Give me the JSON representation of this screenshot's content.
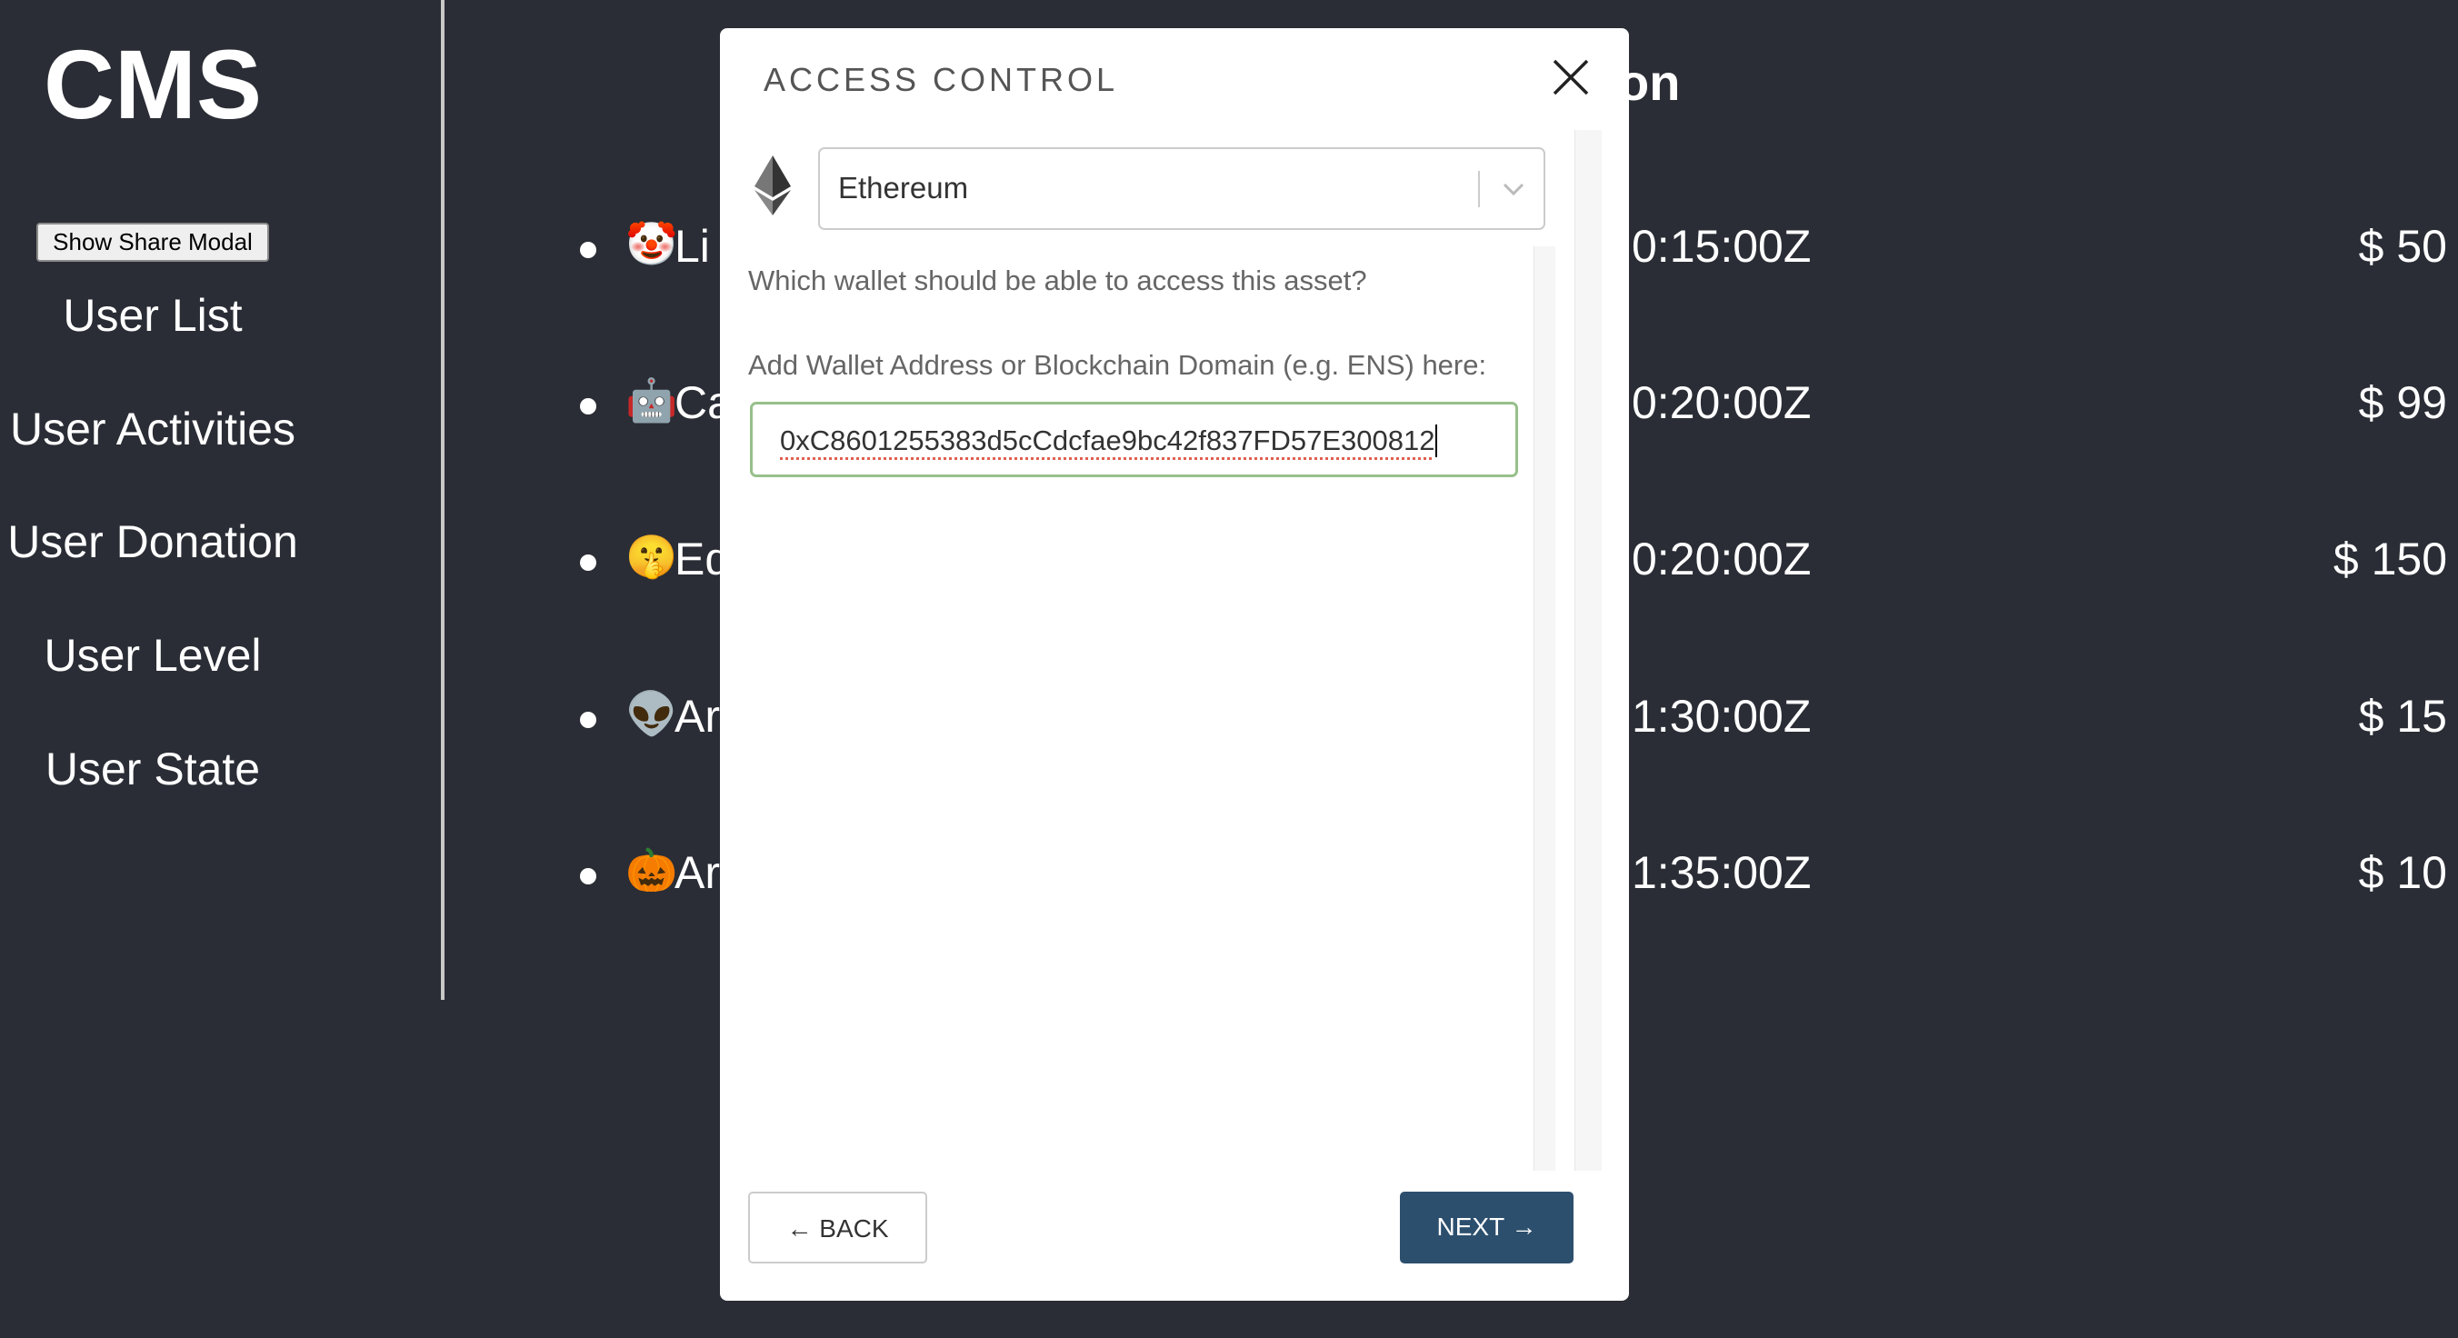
{
  "sidebar": {
    "title": "CMS",
    "share_button": "Show Share Modal",
    "items": [
      "User List",
      "User Activities",
      "User Donation",
      "User Level",
      "User State"
    ]
  },
  "main": {
    "title_visible": "on",
    "rows": [
      {
        "emoji": "🤡",
        "name": "Li",
        "time": "0:15:00Z",
        "amount": "$ 50"
      },
      {
        "emoji": "🤖",
        "name": "Ca",
        "time": "0:20:00Z",
        "amount": "$ 99"
      },
      {
        "emoji": "🤫",
        "name": "Ed",
        "time": "0:20:00Z",
        "amount": "$ 150"
      },
      {
        "emoji": "👽",
        "name": "Ar",
        "time": "1:30:00Z",
        "amount": "$ 15"
      },
      {
        "emoji": "🎃",
        "name": "Ar",
        "time": "1:35:00Z",
        "amount": "$ 10"
      }
    ]
  },
  "modal": {
    "title": "ACCESS CONTROL",
    "chain_icon": "ethereum-icon",
    "chain": "Ethereum",
    "question": "Which wallet should be able to access this asset?",
    "address_label": "Add Wallet Address or Blockchain Domain (e.g. ENS) here:",
    "address_value": "0xC8601255383d5cCdcfae9bc42f837FD57E300812",
    "back": "← BACK",
    "next": "NEXT →",
    "next_color": "#2d4f6e",
    "input_border": "#97c08a"
  }
}
